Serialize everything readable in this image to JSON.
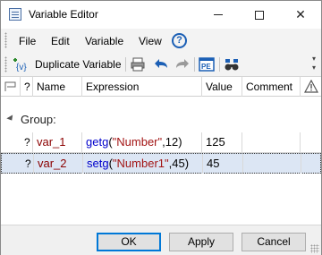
{
  "window": {
    "title": "Variable Editor"
  },
  "menu": {
    "items": [
      "File",
      "Edit",
      "Variable",
      "View"
    ],
    "help_glyph": "?"
  },
  "toolbar": {
    "duplicate_label": "Duplicate Variable",
    "icons": [
      "duplicate-variable-icon",
      "print-icon",
      "undo-icon",
      "redo-icon",
      "properties-icon",
      "find-icon"
    ]
  },
  "table": {
    "columns": [
      "?",
      "Name",
      "Expression",
      "Value",
      "Comment"
    ],
    "group_label": "Group:",
    "rows": [
      {
        "flag": "?",
        "name": "var_1",
        "expr_fn": "getg",
        "expr_open": "(",
        "expr_str": "\"Number\"",
        "expr_sep": ",",
        "expr_num": "12",
        "expr_close": ")",
        "value": "125",
        "comment": "",
        "selected": false
      },
      {
        "flag": "?",
        "name": "var_2",
        "expr_fn": "setg",
        "expr_open": "(",
        "expr_str": "\"Number1\"",
        "expr_sep": ",",
        "expr_num": "45",
        "expr_close": ")",
        "value": "45",
        "comment": "",
        "selected": true
      }
    ]
  },
  "buttons": {
    "ok": "OK",
    "apply": "Apply",
    "cancel": "Cancel"
  },
  "colors": {
    "accent": "#0078d7",
    "selection": "#dce6f4",
    "name_text": "#8b0000",
    "function_text": "#0000cc",
    "string_text": "#a31515"
  }
}
